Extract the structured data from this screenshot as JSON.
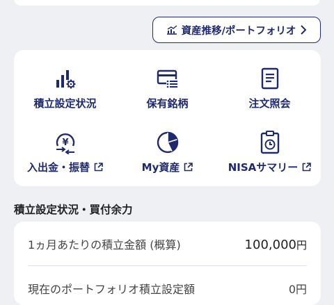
{
  "asset_button": {
    "label": "資産推移/ポートフォリオ",
    "icon": "chart-icon"
  },
  "menu": [
    {
      "label": "積立設定状況",
      "icon": "bar-gear-icon",
      "external": false
    },
    {
      "label": "保有銘柄",
      "icon": "card-list-icon",
      "external": false
    },
    {
      "label": "注文照会",
      "icon": "document-icon",
      "external": false
    },
    {
      "label": "入出金・振替",
      "icon": "yen-transfer-icon",
      "external": true
    },
    {
      "label": "My資産",
      "icon": "pie-icon",
      "external": true
    },
    {
      "label": "NISAサマリー",
      "icon": "clipboard-clock-icon",
      "external": true
    }
  ],
  "section": {
    "title": "積立設定状況・買付余力",
    "row1_label": "1ヵ月あたりの積立金額 (概算)",
    "row1_value": "100,000",
    "row1_unit": "円",
    "row2_label": "現在のポートフォリオ積立設定額",
    "row2_value": "0円"
  },
  "colors": {
    "navy": "#1e2a6e",
    "background": "#eef0f4"
  }
}
